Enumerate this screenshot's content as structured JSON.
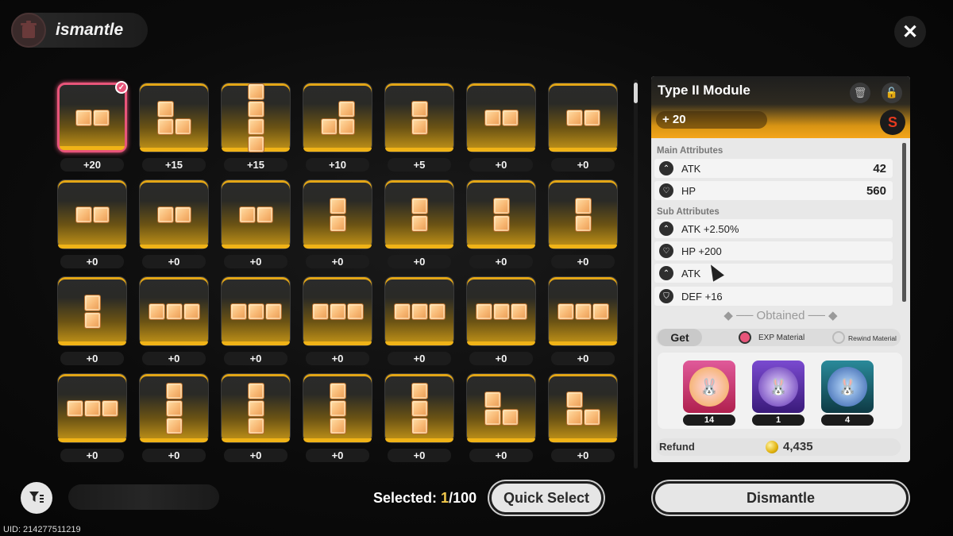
{
  "header": {
    "title": "ismantle",
    "icon": "trash-can-icon"
  },
  "close_icon": "✕",
  "modules": [
    {
      "level": "+20",
      "shape": "h2",
      "selected": true
    },
    {
      "level": "+15",
      "shape": "L"
    },
    {
      "level": "+15",
      "shape": "v4"
    },
    {
      "level": "+10",
      "shape": "J"
    },
    {
      "level": "+5",
      "shape": "v2"
    },
    {
      "level": "+0",
      "shape": "h2"
    },
    {
      "level": "+0",
      "shape": "h2"
    },
    {
      "level": "+0",
      "shape": "h2"
    },
    {
      "level": "+0",
      "shape": "h2"
    },
    {
      "level": "+0",
      "shape": "h2"
    },
    {
      "level": "+0",
      "shape": "v2"
    },
    {
      "level": "+0",
      "shape": "v2"
    },
    {
      "level": "+0",
      "shape": "v2"
    },
    {
      "level": "+0",
      "shape": "v2"
    },
    {
      "level": "+0",
      "shape": "v2"
    },
    {
      "level": "+0",
      "shape": "h3"
    },
    {
      "level": "+0",
      "shape": "h3"
    },
    {
      "level": "+0",
      "shape": "h3"
    },
    {
      "level": "+0",
      "shape": "h3"
    },
    {
      "level": "+0",
      "shape": "h3"
    },
    {
      "level": "+0",
      "shape": "h3"
    },
    {
      "level": "+0",
      "shape": "h3"
    },
    {
      "level": "+0",
      "shape": "v3"
    },
    {
      "level": "+0",
      "shape": "v3"
    },
    {
      "level": "+0",
      "shape": "v3"
    },
    {
      "level": "+0",
      "shape": "v3"
    },
    {
      "level": "+0",
      "shape": "L"
    },
    {
      "level": "+0",
      "shape": "L"
    }
  ],
  "detail": {
    "title": "Type II Module",
    "level": "+ 20",
    "brand_badge": "S",
    "main_title": "Main Attributes",
    "main": [
      {
        "name": "ATK",
        "value": "42",
        "icon": "atk-icon"
      },
      {
        "name": "HP",
        "value": "560",
        "icon": "hp-icon"
      }
    ],
    "sub_title": "Sub Attributes",
    "sub": [
      {
        "name": "ATK +2.50%",
        "icon": "atk-icon"
      },
      {
        "name": "HP +200",
        "icon": "hp-icon"
      },
      {
        "name": "ATK",
        "icon": "atk-icon"
      },
      {
        "name": "DEF +16",
        "icon": "def-icon"
      }
    ],
    "obtained": "Obtained",
    "get_label": "Get",
    "exp_material": "EXP Material",
    "rewind_material": "Rewind Material",
    "materials": [
      {
        "count": "14",
        "color": "#c8326e",
        "icon": "bunny-exp-icon"
      },
      {
        "count": "1",
        "color": "#5a2a9e",
        "icon": "bunny-exp-icon"
      },
      {
        "count": "4",
        "color": "#1f6e7a",
        "icon": "bunny-exp-icon"
      }
    ],
    "refund_label": "Refund",
    "refund_value": "4,435"
  },
  "bottom": {
    "selected_label": "Selected: ",
    "selected_count": "1",
    "selected_total": "/100",
    "quick_select": "Quick Select",
    "dismantle": "Dismantle",
    "uid": "UID: 214277511219"
  }
}
